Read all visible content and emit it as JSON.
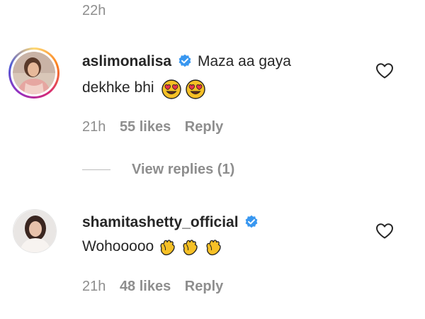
{
  "top": {
    "timestamp": "22h"
  },
  "comments": [
    {
      "username": "aslimonalisa",
      "verified": true,
      "text_line1": "Maza aa gaya",
      "text_line2": "dekhke bhi",
      "emojis": [
        "heart-eyes-emoji",
        "heart-eyes-emoji"
      ],
      "time": "21h",
      "likes": "55 likes",
      "reply": "Reply",
      "has_story_ring": true,
      "view_replies": "View replies (1)"
    },
    {
      "username": "shamitashetty_official",
      "verified": true,
      "text": "Wohooooo",
      "emojis": [
        "clapping-hands-emoji",
        "clapping-hands-emoji",
        "clapping-hands-emoji"
      ],
      "time": "21h",
      "likes": "48 likes",
      "reply": "Reply",
      "has_story_ring": false
    }
  ],
  "colors": {
    "verified_blue": "#3897f0",
    "meta_gray": "#8e8e8e",
    "text": "#262626",
    "emoji_yellow": "#f6c026",
    "heart_eye_red": "#e8334a"
  },
  "icons": [
    "verified-badge-icon",
    "heart-outline-icon"
  ]
}
